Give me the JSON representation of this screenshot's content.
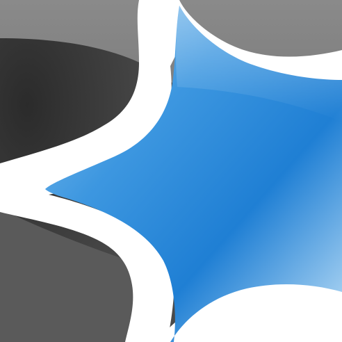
{
  "icon": {
    "name": "star-logo-icon",
    "colors": {
      "background_light": "#8a8a8a",
      "background_mid": "#5c5c5c",
      "background_dark": "#2b2b2b",
      "star_outline": "#ffffff",
      "star_light_blue": "#8ec6f0",
      "star_mid_blue": "#3d97e0",
      "star_deep_blue": "#1f7fd4",
      "star_pale_blue": "#bfe0f7"
    }
  }
}
